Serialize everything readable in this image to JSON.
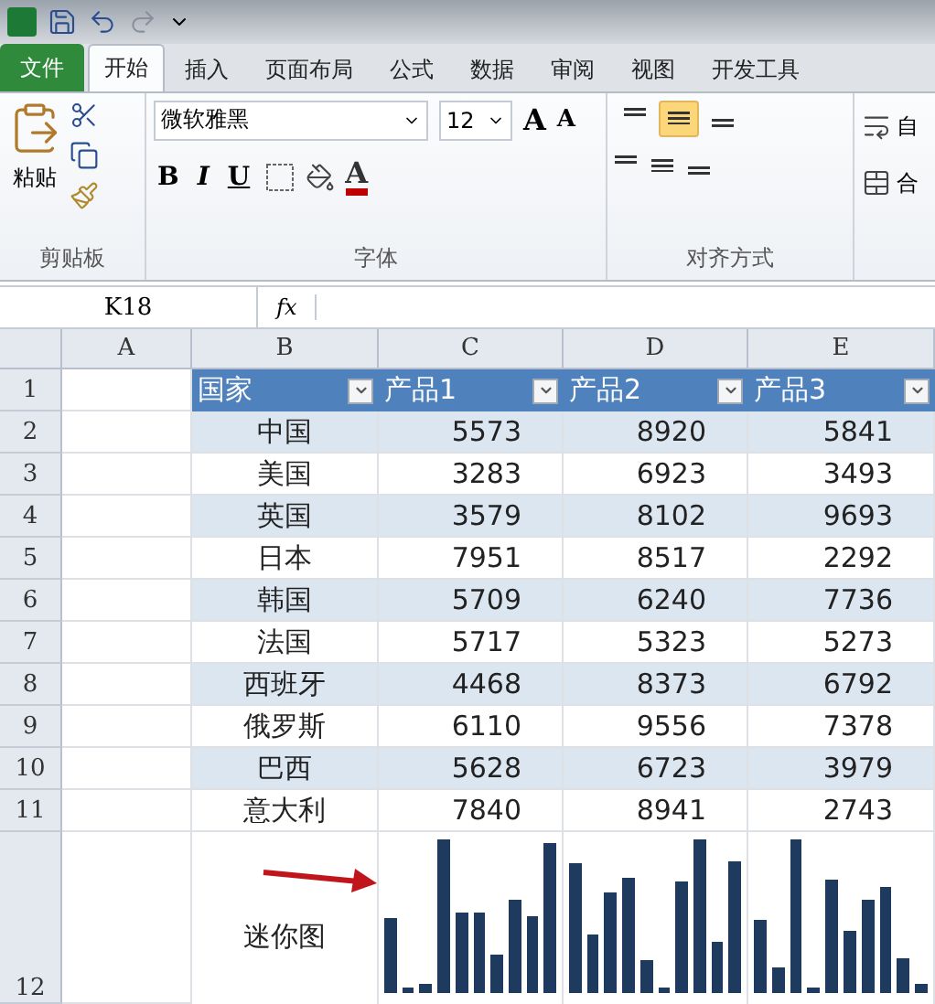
{
  "tabs": [
    {
      "label": "文件",
      "kind": "file",
      "selected": false
    },
    {
      "label": "开始",
      "kind": "tab",
      "selected": true
    },
    {
      "label": "插入",
      "kind": "tab",
      "selected": false
    },
    {
      "label": "页面布局",
      "kind": "tab",
      "selected": false
    },
    {
      "label": "公式",
      "kind": "tab",
      "selected": false
    },
    {
      "label": "数据",
      "kind": "tab",
      "selected": false
    },
    {
      "label": "审阅",
      "kind": "tab",
      "selected": false
    },
    {
      "label": "视图",
      "kind": "tab",
      "selected": false
    },
    {
      "label": "开发工具",
      "kind": "tab",
      "selected": false
    }
  ],
  "ribbon": {
    "clipboard": {
      "paste_label": "粘贴",
      "group_label": "剪贴板"
    },
    "font": {
      "font_name": "微软雅黑",
      "font_size": "12",
      "grow_label": "A",
      "shrink_label": "A",
      "style_buttons": [
        {
          "label": "B",
          "kind": "bold"
        },
        {
          "label": "I",
          "kind": "italic"
        },
        {
          "label": "U",
          "kind": "underline"
        }
      ],
      "color_label": "A",
      "group_label": "字体"
    },
    "alignment": {
      "vertical_buttons": [
        {
          "kind": "top",
          "selected": false
        },
        {
          "kind": "middle",
          "selected": true
        },
        {
          "kind": "bottom",
          "selected": false
        }
      ],
      "group_label": "对齐方式",
      "wrap_label": "自",
      "merge_label": "合"
    }
  },
  "formula_bar": {
    "name_box": "K18",
    "fx_label": "fx"
  },
  "sheet": {
    "columns": [
      "A",
      "B",
      "C",
      "D",
      "E"
    ],
    "row_numbers": [
      "1",
      "2",
      "3",
      "4",
      "5",
      "6",
      "7",
      "8",
      "9",
      "10",
      "11",
      "12"
    ],
    "table_header": [
      "国家",
      "产品1",
      "产品2",
      "产品3"
    ],
    "rows": [
      {
        "country": "中国",
        "values": [
          "5573",
          "8920",
          "5841"
        ]
      },
      {
        "country": "美国",
        "values": [
          "3283",
          "6923",
          "3493"
        ]
      },
      {
        "country": "英国",
        "values": [
          "3579",
          "8102",
          "9693"
        ]
      },
      {
        "country": "日本",
        "values": [
          "7951",
          "8517",
          "2292"
        ]
      },
      {
        "country": "韩国",
        "values": [
          "5709",
          "6240",
          "7736"
        ]
      },
      {
        "country": "法国",
        "values": [
          "5717",
          "5323",
          "5273"
        ]
      },
      {
        "country": "西班牙",
        "values": [
          "4468",
          "8373",
          "6792"
        ]
      },
      {
        "country": "俄罗斯",
        "values": [
          "6110",
          "9556",
          "7378"
        ]
      },
      {
        "country": "巴西",
        "values": [
          "5628",
          "6723",
          "3979"
        ]
      },
      {
        "country": "意大利",
        "values": [
          "7840",
          "8941",
          "2743"
        ]
      }
    ],
    "sparkline_label": "迷你图"
  }
}
